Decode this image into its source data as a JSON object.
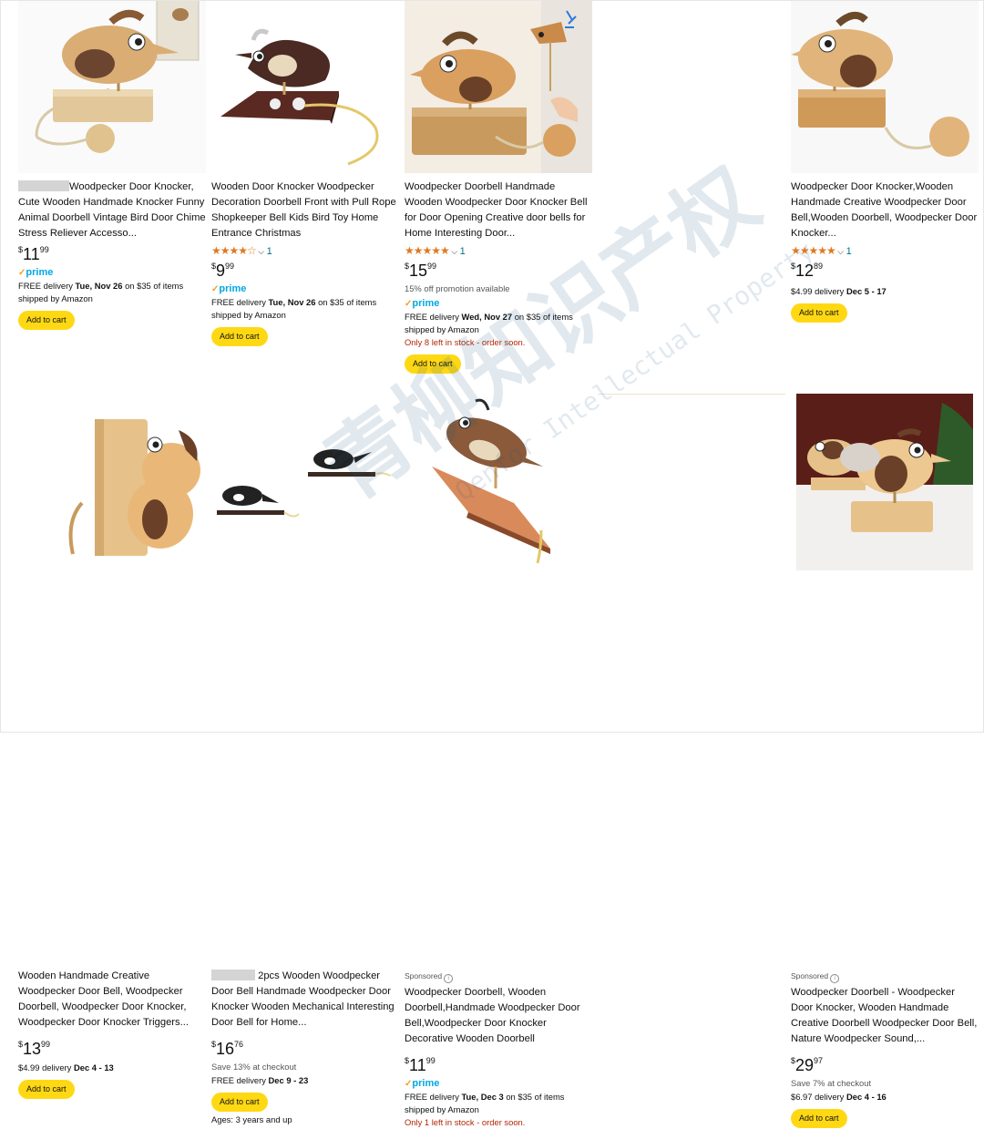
{
  "products": [
    {
      "title_rest": "Woodpecker Door Knocker, Cute Wooden Handmade Knocker Funny Animal Doorbell Vintage Bird Door Chime Stress Reliever Accesso...",
      "price_whole": "11",
      "price_frac": "99",
      "prime": "prime",
      "delivery_pre": "FREE delivery ",
      "delivery_date": "Tue, Nov 26",
      "delivery_post": " on $35 of items shipped by Amazon",
      "button": "Add to cart"
    },
    {
      "title": "Wooden Door Knocker Woodpecker Decoration Doorbell Front with Pull Rope Shopkeeper Bell Kids Bird Toy Home Entrance Christmas",
      "stars": "★★★★☆",
      "rating_count": "1",
      "price_whole": "9",
      "price_frac": "99",
      "prime": "prime",
      "delivery_pre": "FREE delivery ",
      "delivery_date": "Tue, Nov 26",
      "delivery_post": " on $35 of items shipped by Amazon",
      "button": "Add to cart"
    },
    {
      "title": "Woodpecker Doorbell Handmade Wooden Woodpecker Door Knocker Bell for Door Opening Creative door bells for Home Interesting Door...",
      "stars": "★★★★★",
      "rating_count": "1",
      "price_whole": "15",
      "price_frac": "99",
      "promo": "15% off promotion available",
      "prime": "prime",
      "delivery_pre": "FREE delivery ",
      "delivery_date": "Wed, Nov 27",
      "delivery_post": " on $35 of items shipped by Amazon",
      "stock": "Only 8 left in stock - order soon.",
      "button": "Add to cart"
    },
    {
      "title": "Woodpecker Door Knocker,Wooden Handmade Creative Woodpecker Door Bell,Wooden Doorbell, Woodpecker Door Knocker...",
      "stars": "★★★★★",
      "rating_count": "1",
      "price_whole": "12",
      "price_frac": "89",
      "delivery_pre": "$4.99 delivery ",
      "delivery_date": "Dec 5 - 17",
      "button": "Add to cart"
    },
    {
      "title": "Wooden Handmade Creative Woodpecker Door Bell, Woodpecker Doorbell, Woodpecker Door Knocker, Woodpecker Door Knocker Triggers...",
      "price_whole": "13",
      "price_frac": "99",
      "delivery_pre": "$4.99 delivery ",
      "delivery_date": "Dec 4 - 13",
      "button": "Add to cart"
    },
    {
      "title_rest": " 2pcs Wooden Woodpecker Door Bell Handmade Woodpecker Door Knocker Wooden Mechanical Interesting Door Bell for Home...",
      "price_whole": "16",
      "price_frac": "76",
      "promo": "Save 13% at checkout",
      "delivery_pre": "FREE delivery ",
      "delivery_date": "Dec 9 - 23",
      "button": "Add to cart",
      "ages": "Ages: 3 years and up"
    },
    {
      "sponsored": "Sponsored",
      "title": "Woodpecker Doorbell, Wooden Doorbell,Handmade Woodpecker Door Bell,Woodpecker Door Knocker Decorative Wooden Doorbell",
      "price_whole": "11",
      "price_frac": "99",
      "prime": "prime",
      "delivery_pre": "FREE delivery ",
      "delivery_date": "Tue, Dec 3",
      "delivery_post": " on $35 of items shipped by Amazon",
      "stock": "Only 1 left in stock - order soon."
    },
    {
      "sponsored": "Sponsored",
      "title": "Woodpecker Doorbell - Woodpecker Door Knocker, Wooden Handmade Creative Doorbell Woodpecker Door Bell, Nature Woodpecker Sound,...",
      "price_whole": "29",
      "price_frac": "97",
      "promo": "Save 7% at checkout",
      "delivery_pre": "$6.97 delivery ",
      "delivery_date": "Dec 4 - 16",
      "button": "Add to cart"
    }
  ],
  "currency": "$",
  "watermark": {
    "text_cn": "青柳知识产权",
    "text_en": "Qenfor Intellectual Property"
  },
  "colors": {
    "button": "#ffd814",
    "prime": "#00a8e1",
    "stars": "#de7921",
    "stock": "#b12704",
    "link": "#007185"
  }
}
